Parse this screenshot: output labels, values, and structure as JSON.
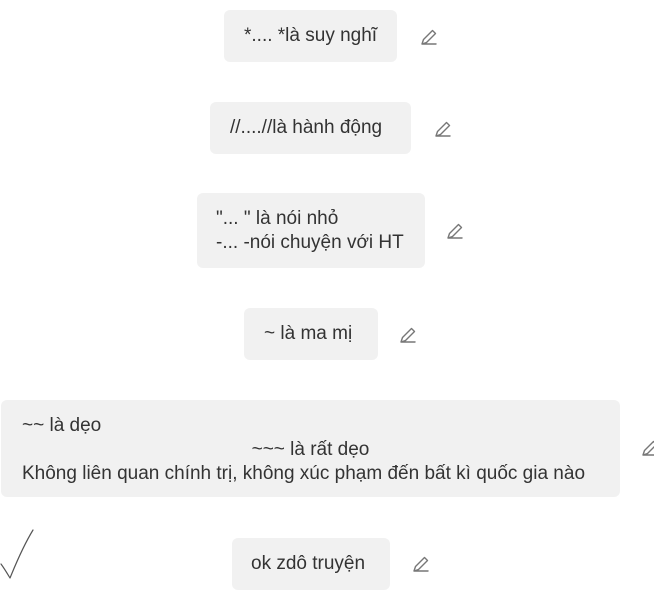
{
  "messages": [
    {
      "lines": [
        "*.... *là suy nghĩ"
      ]
    },
    {
      "lines": [
        "//....//là hành động"
      ]
    },
    {
      "lines": [
        "\"... \" là nói nhỏ",
        "-... -nói chuyện với HT"
      ]
    },
    {
      "lines": [
        "~ là ma mị"
      ]
    },
    {
      "lines": [
        "~~ là dẹo",
        "~~~ là rất dẹo",
        "Không liên quan chính trị, không xúc phạm đến bất kì quốc gia nào"
      ]
    },
    {
      "lines": [
        "ok zdô truyện"
      ]
    }
  ],
  "icons": {
    "edit": "pencil-icon",
    "mark": "checkmark-icon"
  },
  "colors": {
    "bubble": "#f1f1f1",
    "text": "#333333",
    "icon": "#777777"
  }
}
